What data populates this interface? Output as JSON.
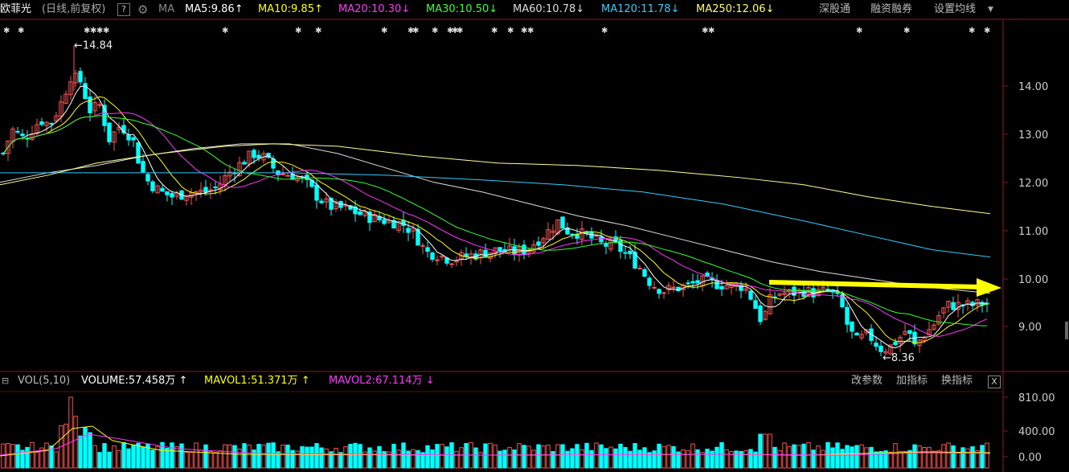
{
  "header": {
    "stock_name": "欧菲光",
    "mode": "(日线,前复权)",
    "help": "?",
    "ma_label": "MA",
    "ma": [
      {
        "text": "MA5:9.86",
        "arrow": "↑",
        "color": "#ffffff"
      },
      {
        "text": "MA10:9.85",
        "arrow": "↑",
        "color": "#ffff00"
      },
      {
        "text": "MA20:10.30",
        "arrow": "↓",
        "color": "#ff33ff"
      },
      {
        "text": "MA30:10.50",
        "arrow": "↓",
        "color": "#33ff33"
      },
      {
        "text": "MA60:10.78",
        "arrow": "↓",
        "color": "#dddddd"
      },
      {
        "text": "MA120:11.78",
        "arrow": "↓",
        "color": "#33ccff"
      },
      {
        "text": "MA250:12.06",
        "arrow": "↓",
        "color": "#ffff66"
      }
    ],
    "menu": [
      "深股通",
      "融资融券",
      "设置均线"
    ]
  },
  "price_axis": [
    "14.00",
    "13.00",
    "12.00",
    "11.00",
    "10.00",
    "9.00"
  ],
  "annotations": {
    "high": "14.84",
    "low": "8.36"
  },
  "volume_bar": {
    "title": "VOL(5,10)",
    "volume": "VOLUME:57.458万",
    "volume_arrow": "↑",
    "mavol1": "MAVOL1:51.371万",
    "mavol1_arrow": "↑",
    "mavol2": "MAVOL2:67.114万",
    "mavol2_arrow": "↓",
    "buttons": [
      "改参数",
      "加指标",
      "换指标"
    ],
    "close": "X"
  },
  "volume_axis": [
    "810.00",
    "400.00",
    "0.00"
  ],
  "colors": {
    "up": "#ff5050",
    "down": "#00ffff",
    "arrow": "#ffff00"
  }
}
